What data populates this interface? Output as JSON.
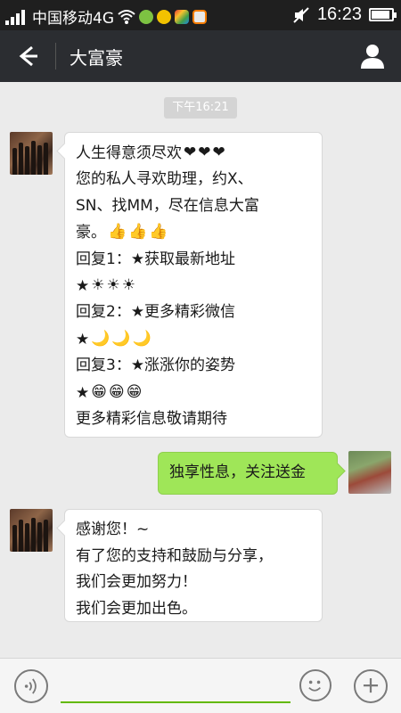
{
  "status_bar": {
    "carrier": "中国移动4G",
    "time": "16:23",
    "icons": [
      "signal-icon",
      "wifi-icon",
      "app-icon",
      "app-icon",
      "app-icon",
      "app-icon",
      "mute-icon",
      "battery-icon"
    ]
  },
  "header": {
    "title": "大富豪",
    "back_icon": "back-arrow-icon",
    "profile_icon": "person-icon"
  },
  "chat": {
    "timestamp": "下午16:21",
    "messages": [
      {
        "sender": "other",
        "lines": [
          {
            "text": "人生得意须尽欢",
            "emoji": [
              "heart",
              "heart",
              "heart"
            ]
          },
          {
            "text": "您的私人寻欢助理，约X、"
          },
          {
            "text": "SN、找MM，尽在信息大富"
          },
          {
            "text": "豪。",
            "emoji": [
              "thumbs-up",
              "thumbs-up",
              "thumbs-up"
            ]
          },
          {
            "text": "回复1：★获取最新地址"
          },
          {
            "text": "★",
            "emoji": [
              "sun",
              "sun",
              "sun"
            ]
          },
          {
            "text": "回复2：★更多精彩微信"
          },
          {
            "text": "★",
            "emoji": [
              "moon",
              "moon",
              "moon"
            ]
          },
          {
            "text": "回复3：★涨涨你的姿势"
          },
          {
            "text": "★",
            "emoji": [
              "grin",
              "grin",
              "grin"
            ]
          },
          {
            "text": "更多精彩信息敬请期待"
          }
        ]
      },
      {
        "sender": "self",
        "lines": [
          {
            "text": "独享性息，关注送金"
          }
        ]
      },
      {
        "sender": "other",
        "lines": [
          {
            "text": "感谢您！~"
          },
          {
            "text": "有了您的支持和鼓励与分享，"
          },
          {
            "text": "我们会更加努力！"
          },
          {
            "text": "我们会更加出色。"
          }
        ]
      }
    ]
  },
  "input_bar": {
    "placeholder": "",
    "icons": [
      "voice-icon",
      "emoji-icon",
      "plus-icon"
    ]
  },
  "colors": {
    "status_bar": "#1f1f1f",
    "title_bar": "#2b2d31",
    "chat_bg": "#ebebeb",
    "self_bubble": "#9fe658",
    "input_underline": "#62b900"
  }
}
